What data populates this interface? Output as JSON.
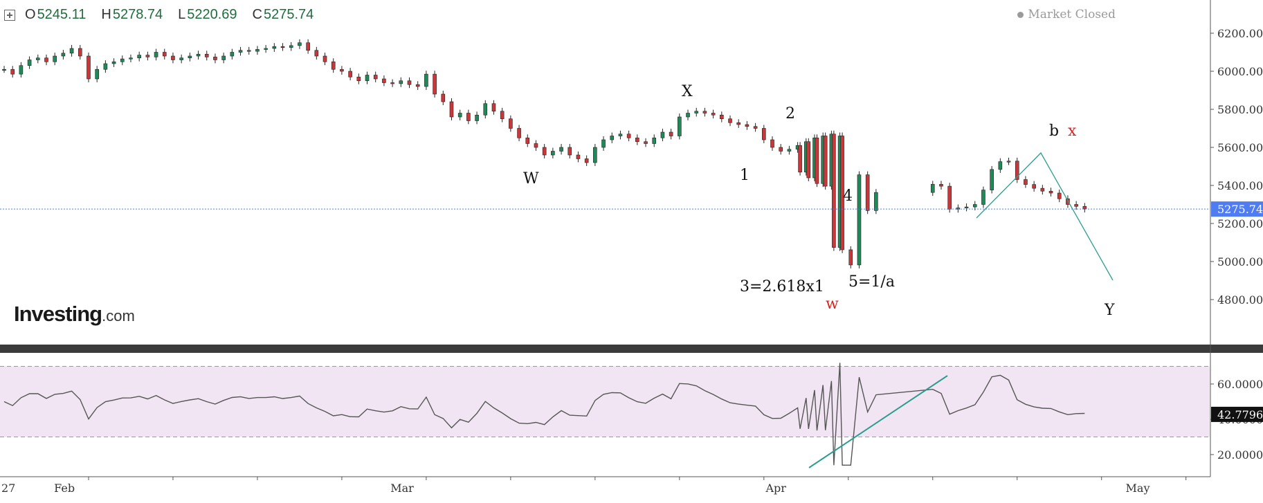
{
  "toolbar": {
    "open_label": "O",
    "open": "5245.11",
    "high_label": "H",
    "high": "5278.74",
    "low_label": "L",
    "low": "5220.69",
    "close_label": "C",
    "close": "5275.74"
  },
  "status": {
    "text": "Market Closed"
  },
  "logo": {
    "main": "Investing",
    "domain": ".com"
  },
  "chart_data": [
    {
      "type": "candlestick",
      "title": "",
      "price_axis": {
        "ticks": [
          "6200.00",
          "6000.00",
          "5800.00",
          "5600.00",
          "5400.00",
          "5200.00",
          "5000.00",
          "4800.00"
        ],
        "range": [
          4590,
          6330
        ]
      },
      "last_price": {
        "value": 5275.74,
        "label": "5275.74"
      },
      "time_axis": {
        "labels": [
          "27",
          "Feb",
          "Mar",
          "Apr",
          "May"
        ],
        "range": [
          "2025-01-27",
          "2025-05-05"
        ]
      },
      "series": [
        {
          "start": "2025-01-27",
          "values": [
            6010,
            5985,
            6030,
            6060,
            6070,
            6050,
            6080,
            6095,
            6120,
            6080
          ]
        },
        {
          "start": "2025-02-03",
          "values": [
            5960,
            6010,
            6040,
            6050,
            6065,
            6070,
            6085,
            6075,
            6100,
            6080
          ]
        },
        {
          "start": "2025-02-10",
          "values": [
            6060,
            6070,
            6080,
            6090,
            6075,
            6060,
            6080,
            6100,
            6110,
            6105
          ]
        },
        {
          "start": "2025-02-17",
          "values": [
            6115,
            6120,
            6130,
            6125,
            6135,
            6150,
            6110,
            6080,
            6050,
            6010
          ]
        },
        {
          "start": "2025-02-24",
          "values": [
            6000,
            5970,
            5950,
            5980,
            5960,
            5940,
            5935,
            5950,
            5930,
            5920
          ]
        },
        {
          "start": "2025-03-03",
          "values": [
            5985,
            5880,
            5840,
            5760,
            5780,
            5740,
            5770,
            5830,
            5790,
            5750
          ]
        },
        {
          "start": "2025-03-10",
          "values": [
            5700,
            5650,
            5620,
            5600,
            5560,
            5580,
            5600,
            5560,
            5540,
            5520
          ]
        },
        {
          "start": "2025-03-17",
          "values": [
            5600,
            5640,
            5660,
            5670,
            5650,
            5630,
            5620,
            5650,
            5680,
            5660
          ]
        },
        {
          "start": "2025-03-24",
          "values": [
            5760,
            5780,
            5790,
            5780,
            5770,
            5750,
            5730,
            5720,
            5710,
            5700
          ]
        },
        {
          "start": "2025-03-31",
          "values": [
            5640,
            5600,
            5580,
            5590,
            5610,
            5630,
            5650,
            5660,
            5670,
            5660
          ]
        },
        {
          "start": "2025-04-03",
          "values": [
            5470,
            5440,
            5410,
            5396,
            5074,
            5062,
            4982,
            5456,
            5268,
            5363
          ]
        },
        {
          "start": "2025-04-14",
          "values": [
            5406,
            5396,
            5275,
            5282,
            5287,
            5300,
            5376,
            5484,
            5525,
            5528
          ]
        },
        {
          "start": "2025-04-21",
          "values": [
            5431,
            5405,
            5385,
            5370,
            5360,
            5330,
            5300,
            5290,
            5276
          ]
        }
      ],
      "note": "values are approximate closes read from the price axis"
    },
    {
      "type": "line",
      "title": "",
      "indicator": "RSI",
      "y_axis": {
        "ticks": [
          "60.0000",
          "40.0000",
          "20.0000"
        ],
        "range": [
          10,
          75
        ]
      },
      "band": [
        30,
        70
      ],
      "last_value": {
        "value": 42.7796,
        "label": "42.7796"
      }
    }
  ],
  "annotations": {
    "wave_labels": [
      "W",
      "X",
      "1",
      "2",
      "3=2.618x1",
      "4",
      "5=1/a",
      "b",
      "x",
      "w",
      "Y"
    ]
  },
  "colors": {
    "up": "#1e8a57",
    "down": "#c8383a",
    "projection": "#2a9d8f",
    "rsi_band": "#f1e5f3",
    "rsi_line": "#555555",
    "price_line": "#4f7cf0",
    "last_price_bg": "#4f7cf0",
    "red_label": "#e02020"
  }
}
